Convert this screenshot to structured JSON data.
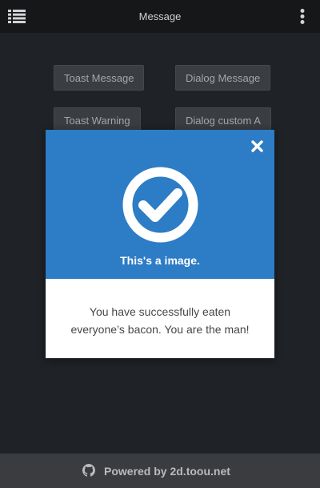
{
  "header": {
    "title": "Message"
  },
  "buttons": {
    "toast_message": "Toast Message",
    "dialog_message": "Dialog Message",
    "toast_warning": "Toast Warning",
    "dialog_custom": "Dialog custom A"
  },
  "dialog": {
    "title": "This's a image.",
    "body": "You have successfully eaten everyone’s bacon. You are the man!",
    "accent_color": "#2d7cc6"
  },
  "footer": {
    "text": "Powered by 2d.toou.net"
  },
  "icons": {
    "menu": "list-icon",
    "more": "more-vertical-icon",
    "close": "close-icon",
    "check": "check-circle-icon",
    "github": "github-icon"
  }
}
